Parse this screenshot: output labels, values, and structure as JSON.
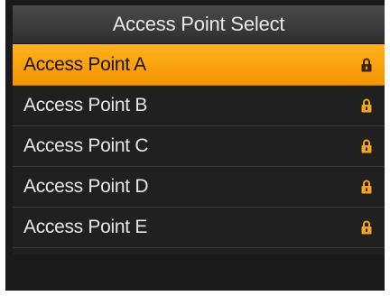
{
  "header": {
    "title": "Access Point Select"
  },
  "access_points": [
    {
      "label": "Access Point A",
      "selected": true,
      "icon": "lock-icon"
    },
    {
      "label": "Access Point B",
      "selected": false,
      "icon": "lock-icon"
    },
    {
      "label": "Access Point C",
      "selected": false,
      "icon": "lock-icon"
    },
    {
      "label": "Access Point D",
      "selected": false,
      "icon": "lock-icon"
    },
    {
      "label": "Access Point E",
      "selected": false,
      "icon": "lock-icon"
    }
  ],
  "colors": {
    "selection": "#f7a30c",
    "lock_icon": "#f3a41a",
    "lock_icon_selected": "#3a2400",
    "background": "#202020"
  }
}
